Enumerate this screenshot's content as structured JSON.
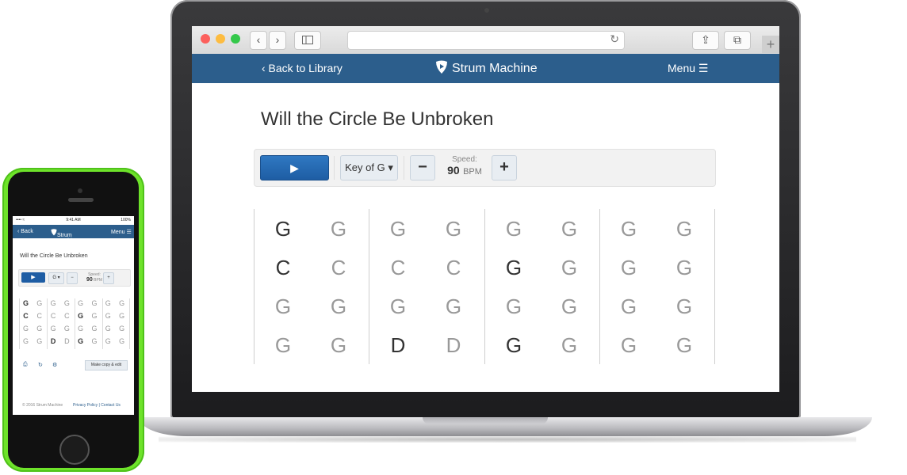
{
  "browser": {
    "nav_back": "‹",
    "nav_forward": "›",
    "sidebar_icon": "sidebar-icon",
    "reload_icon": "↻",
    "share_icon": "⇪",
    "tabs_icon": "⧉",
    "new_tab": "+"
  },
  "header": {
    "back_label": "‹ Back to Library",
    "brand": "Strum Machine",
    "menu_label": "Menu ☰"
  },
  "song": {
    "title": "Will the Circle Be Unbroken"
  },
  "toolbar": {
    "play_label": "▶",
    "key_label": "Key of G ▾",
    "minus_label": "−",
    "plus_label": "+",
    "speed_label": "Speed:",
    "speed_value": "90",
    "speed_unit": "BPM"
  },
  "chord_grid": {
    "rows": [
      [
        "G",
        "G",
        "G",
        "G",
        "G",
        "G",
        "G",
        "G"
      ],
      [
        "C",
        "C",
        "C",
        "C",
        "G",
        "G",
        "G",
        "G"
      ],
      [
        "G",
        "G",
        "G",
        "G",
        "G",
        "G",
        "G",
        "G"
      ],
      [
        "G",
        "G",
        "D",
        "D",
        "G",
        "G",
        "G",
        "G"
      ]
    ],
    "strong": [
      [
        true,
        false,
        false,
        false,
        false,
        false,
        false,
        false
      ],
      [
        true,
        false,
        false,
        false,
        true,
        false,
        false,
        false
      ],
      [
        false,
        false,
        false,
        false,
        false,
        false,
        false,
        false
      ],
      [
        false,
        false,
        true,
        false,
        true,
        false,
        false,
        false
      ]
    ]
  },
  "phone": {
    "status_left": "•••• ≈",
    "status_time": "9:41 AM",
    "status_right": "100%",
    "back_label": "‹ Back",
    "brand": "Strum Machine",
    "menu_label": "Menu ☰",
    "title": "Will the Circle Be Unbroken",
    "play_label": "▶",
    "key_label": "G ▾",
    "minus_label": "−",
    "plus_label": "+",
    "speed_label": "Speed:",
    "speed_value": "90",
    "speed_unit": "BPM",
    "chord_rows": [
      [
        "G",
        "G",
        "G",
        "G",
        "G",
        "G",
        "G",
        "G"
      ],
      [
        "C",
        "C",
        "C",
        "C",
        "G",
        "G",
        "G",
        "G"
      ],
      [
        "G",
        "G",
        "G",
        "G",
        "G",
        "G",
        "G",
        "G"
      ],
      [
        "G",
        "G",
        "D",
        "D",
        "G",
        "G",
        "G",
        "G"
      ]
    ],
    "chord_strong": [
      [
        true,
        false,
        false,
        false,
        false,
        false,
        false,
        false
      ],
      [
        true,
        false,
        false,
        false,
        true,
        false,
        false,
        false
      ],
      [
        false,
        false,
        false,
        false,
        false,
        false,
        false,
        false
      ],
      [
        false,
        false,
        true,
        false,
        true,
        false,
        false,
        false
      ]
    ],
    "icon_print": "⎙",
    "icon_refresh": "↻",
    "icon_settings": "⚙",
    "copy_label": "Make copy & edit",
    "footer_left": "© 2016 Strum Machine",
    "footer_right": "Privacy Policy | Contact Us"
  },
  "colors": {
    "header_blue": "#2c5e8c",
    "play_blue": "#1e5da4",
    "phone_green": "#6ee32a"
  }
}
